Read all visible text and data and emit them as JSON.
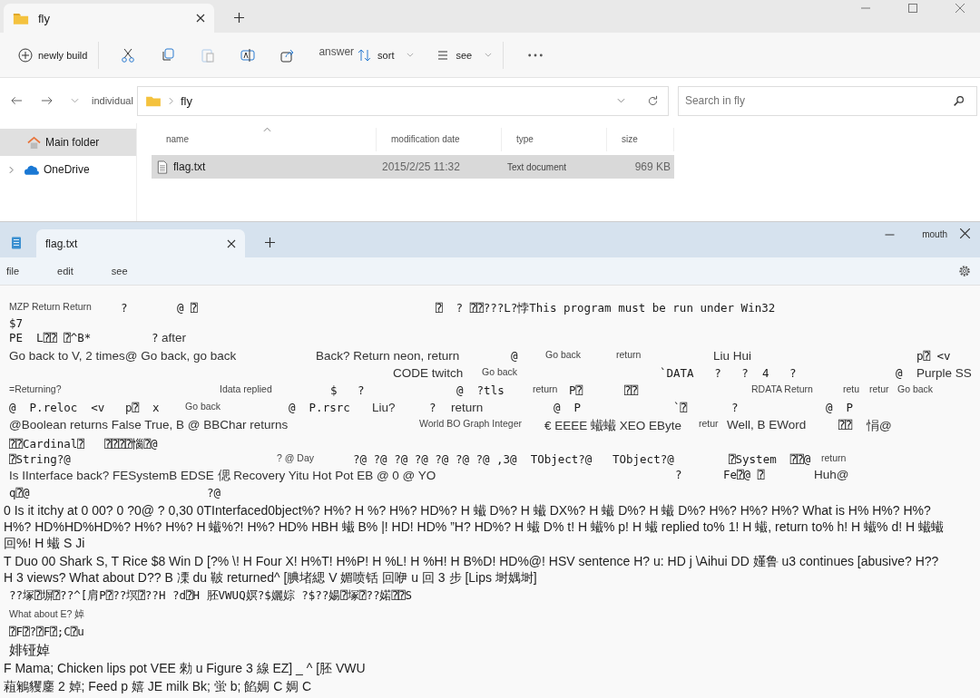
{
  "explorer": {
    "tab": {
      "title": "fly"
    },
    "toolbar": [
      {
        "kind": "new",
        "label": "newly build"
      },
      {
        "kind": "cut"
      },
      {
        "kind": "copy"
      },
      {
        "kind": "paste",
        "disabled": true
      },
      {
        "kind": "rename"
      },
      {
        "kind": "share"
      },
      {
        "kind": "text",
        "label": "answer"
      },
      {
        "kind": "sort",
        "label": "sort"
      },
      {
        "kind": "view",
        "label": "see"
      },
      {
        "kind": "more"
      }
    ],
    "address": {
      "location": "individual",
      "folder": "fly"
    },
    "search": {
      "placeholder": "Search in fly"
    },
    "sidebar": [
      {
        "label": "Main folder",
        "kind": "home",
        "selected": true,
        "expandable": false
      },
      {
        "label": "OneDrive",
        "kind": "cloud",
        "selected": false,
        "expandable": true
      }
    ],
    "columns": [
      "name",
      "modification date",
      "type",
      "size"
    ],
    "rows": [
      {
        "name": "flag.txt",
        "date": "2015/2/25 11:32",
        "type": "Text document",
        "size": "969 KB",
        "selected": true
      }
    ]
  },
  "notepad": {
    "tab": {
      "title": "flag.txt"
    },
    "maximize_label": "mouth",
    "menu": [
      "file",
      "edit",
      "see"
    ],
    "lines": [
      {
        "segments": [
          {
            "kind": "small",
            "text": "MZP Return Return"
          },
          {
            "kind": "mono",
            "text": "?"
          },
          {
            "kind": "mono",
            "text": "@ ⍰"
          },
          {
            "kind": "mono",
            "text": "⍰  ? ⍰⍰???L?悖This program must be run under Win32"
          }
        ]
      },
      {
        "segments": [
          {
            "kind": "mono",
            "text": "$7"
          }
        ]
      },
      {
        "segments": [
          {
            "kind": "mono",
            "text": "PE  L⍰⍰ ⍰^B*"
          },
          {
            "kind": "mono",
            "text": "?"
          },
          {
            "kind": "sans",
            "text": "after"
          }
        ]
      },
      {
        "segments": [
          {
            "kind": "sans",
            "text": "Go back to V, 2 times@ Go back, go back"
          },
          {
            "kind": "sans",
            "text": "Back? Return neon, return"
          },
          {
            "kind": "mono",
            "text": "@"
          },
          {
            "kind": "small",
            "text": "Go back"
          },
          {
            "kind": "small",
            "text": "return"
          },
          {
            "kind": "sans",
            "text": "Liu Hui"
          },
          {
            "kind": "mono",
            "text": "p⍰ <v"
          }
        ]
      },
      {
        "segments": [
          {
            "kind": "sans",
            "text": "CODE twitch"
          },
          {
            "kind": "small",
            "text": "Go back"
          },
          {
            "kind": "mono",
            "text": "`DATA   ?   ?  4   ?"
          },
          {
            "kind": "mono",
            "text": "@"
          },
          {
            "kind": "sans",
            "text": "Purple SS"
          }
        ]
      },
      {
        "segments": [
          {
            "kind": "small",
            "text": "=Returning?"
          },
          {
            "kind": "small",
            "text": "Idata replied"
          },
          {
            "kind": "mono",
            "text": "$   ?"
          },
          {
            "kind": "mono",
            "text": "@  ?tls"
          },
          {
            "kind": "small",
            "text": "return"
          },
          {
            "kind": "mono",
            "text": "P⍰"
          },
          {
            "kind": "mono",
            "text": "⍰⍰"
          },
          {
            "kind": "small",
            "text": "RDATA Return"
          },
          {
            "kind": "small",
            "text": "retu"
          },
          {
            "kind": "small",
            "text": "retur"
          },
          {
            "kind": "small",
            "text": "Go back"
          }
        ]
      },
      {
        "segments": [
          {
            "kind": "mono",
            "text": "@  P.reloc  <v   p⍰  x"
          },
          {
            "kind": "small",
            "text": "Go back"
          },
          {
            "kind": "mono",
            "text": "@  P.rsrc"
          },
          {
            "kind": "sans",
            "text": "Liu?"
          },
          {
            "kind": "mono",
            "text": "?"
          },
          {
            "kind": "sans",
            "text": "return"
          },
          {
            "kind": "mono",
            "text": "@  P"
          },
          {
            "kind": "mono",
            "text": "`⍰"
          },
          {
            "kind": "mono",
            "text": "?"
          },
          {
            "kind": "mono",
            "text": "@  P"
          }
        ]
      },
      {
        "segments": [
          {
            "kind": "sans",
            "text": "@Boolean returns False True, B @ BBChar returns"
          },
          {
            "kind": "small",
            "text": "World BO Graph Integer"
          },
          {
            "kind": "sans",
            "text": "€ EEEE 蠘蠘 XEO EByte"
          },
          {
            "kind": "small",
            "text": "retur"
          },
          {
            "kind": "sans",
            "text": "Well, B EWord"
          },
          {
            "kind": "mono",
            "text": "⍰⍰"
          },
          {
            "kind": "sans",
            "text": "悁@"
          }
        ]
      },
      {
        "segments": [
          {
            "kind": "mono",
            "text": "⍰⍰Cardinal⍰   ⍰⍰⍰⍰惱⍰@"
          }
        ]
      },
      {
        "segments": [
          {
            "kind": "mono",
            "text": "⍰String?@"
          },
          {
            "kind": "small",
            "text": "? @ Day"
          },
          {
            "kind": "mono",
            "text": "?@ ?@ ?@ ?@ ?@ ?@ ?@ ,3@  TObject?@   TObject?@"
          },
          {
            "kind": "mono",
            "text": "⍰System  ⍰⍰@"
          },
          {
            "kind": "small",
            "text": "return"
          }
        ]
      },
      {
        "segments": [
          {
            "kind": "sans",
            "text": "Is IInterface back? FESystemB EDSE 偲 Recovery Yitu Hot Pot EB @ 0 @ YO"
          },
          {
            "kind": "mono",
            "text": "?"
          },
          {
            "kind": "mono",
            "text": "Fe⍰@ ⍰"
          },
          {
            "kind": "sans",
            "text": "Huh@"
          }
        ]
      },
      {
        "segments": [
          {
            "kind": "mono",
            "text": "q⍰@"
          },
          {
            "kind": "mono",
            "text": "?@"
          }
        ]
      }
    ],
    "paragraphs": [
      {
        "kind": "sans",
        "text": "0 Is it itchy at 0 00? 0 ?0@ ? 0,30 0TInterfaced0bject%? H%? H %? H%? HD%? H 蠘 D%? H 蠘 DX%? H 蠘 D%? H 蠘 D%? H%? H%? H%? What is H% H%? H%? H%? HD%HD%HD%? H%? H%? H 蠘%?! H%? HD% HBH 蠘 B% |! HD! HD% ”H? HD%? H 蠘 D% t! H 蠘% p! H 蠘 replied to% 1! H 蠘, return to% h! H 蠘% d! H 蠘蠘回%! H 蠘 S Ji"
      },
      {
        "kind": "sans",
        "text": "T Duo 00 Shark S, T Rice $8 Win D [?% \\! H Four X! H%T! H%P! H %L! H %H! H B%D! HD%@! HSV sentence H? u: HD j \\Aihui DD 嬞鲁 u3 continues [abusive? H?? H 3 views? What about D?? B 凓 du 鞁 returned^ [腆堵緦 V 媚喷铦 回咿 u 回 3 步 [Lips 埘媀埘]"
      },
      {
        "kind": "mono",
        "text": "??塚⍰塀⍰??^[肩P⍰??塓⍰??H ?d⍰H 胚VWUQ嫇?$孋婃 ?$??婸⍰塚⍰??婼⍰⍰S"
      },
      {
        "kind": "small",
        "text": "What about E? 婥"
      },
      {
        "kind": "mono",
        "text": "⍰F⍰?⍰F⍰;C⍰u"
      },
      {
        "kind": "big",
        "text": "婔铔婥"
      },
      {
        "kind": "sans",
        "text": "F Mama; Chicken lips pot VEE 勑 u Figure 3 線 EZ] _ ^ [胚 VWU"
      },
      {
        "kind": "sans",
        "text": "蒩鵴貜鏖 2 婥; Feed p 嬉 JE milk Bk; 蛍 b; 餡婤 C 婤 C"
      }
    ]
  }
}
